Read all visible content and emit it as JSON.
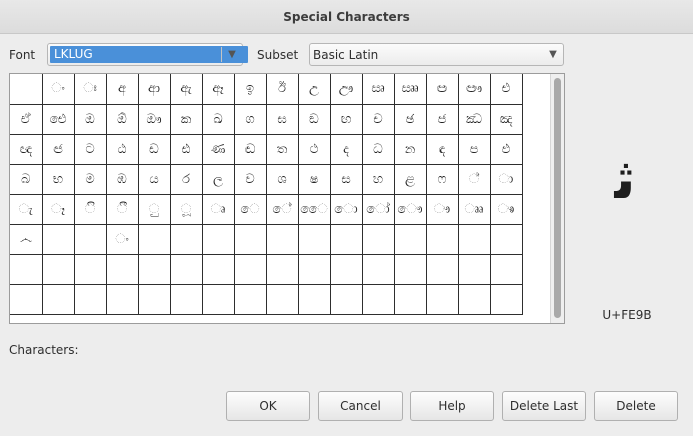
{
  "window": {
    "title": "Special Characters"
  },
  "font": {
    "label": "Font",
    "value": "LKLUG"
  },
  "subset": {
    "label": "Subset",
    "value": "Basic Latin"
  },
  "grid": {
    "rows": [
      [
        "",
        "ං",
        "ඃ",
        "අ",
        "ආ",
        "ඇ",
        "ඈ",
        "ඉ",
        "ඊ",
        "උ",
        "ඌ",
        "ඍ",
        "ඎ",
        "ඏ",
        "ඐ",
        "එ"
      ],
      [
        "ඒ",
        "ඓ",
        "ඔ",
        "ඕ",
        "ඖ",
        "ක",
        "ඛ",
        "ග",
        "ඝ",
        "ඞ",
        "ඟ",
        "ච",
        "ඡ",
        "ජ",
        "ඣ",
        "ඤ"
      ],
      [
        "ඥ",
        "ඦ",
        "ට",
        "ඨ",
        "ඩ",
        "ඪ",
        "ණ",
        "ඬ",
        "ත",
        "ථ",
        "ද",
        "ධ",
        "න",
        "ඳ",
        "ප",
        "ඵ"
      ],
      [
        "බ",
        "භ",
        "ම",
        "ඹ",
        "ය",
        "ර",
        "ල",
        "ව",
        "ශ",
        "ෂ",
        "ස",
        "හ",
        "ළ",
        "ෆ",
        "්",
        "ා"
      ],
      [
        "ැ",
        "ෑ",
        "ි",
        "ී",
        "ු",
        "ූ",
        "ෘ",
        "ෙ",
        "ේ",
        "ෛ",
        "ො",
        "ෝ",
        "ෞ",
        "ෟ",
        "ෲ",
        "ෳ"
      ],
      [
        "෴",
        "",
        "",
        "ං",
        "",
        "",
        "",
        "",
        "",
        "",
        "",
        "",
        "",
        "",
        "",
        ""
      ],
      [
        "",
        "",
        "",
        "",
        "",
        "",
        "",
        "",
        "",
        "",
        "",
        "",
        "",
        "",
        "",
        ""
      ],
      [
        "",
        "",
        "",
        "",
        "",
        "",
        "",
        "",
        "",
        "",
        "",
        "",
        "",
        "",
        "",
        ""
      ]
    ]
  },
  "preview": {
    "glyph": "ﺛ",
    "codepoint": "U+FE9B"
  },
  "characters_label": "Characters:",
  "buttons": {
    "ok": "OK",
    "cancel": "Cancel",
    "help": "Help",
    "delete_last": "Delete Last",
    "delete": "Delete"
  }
}
